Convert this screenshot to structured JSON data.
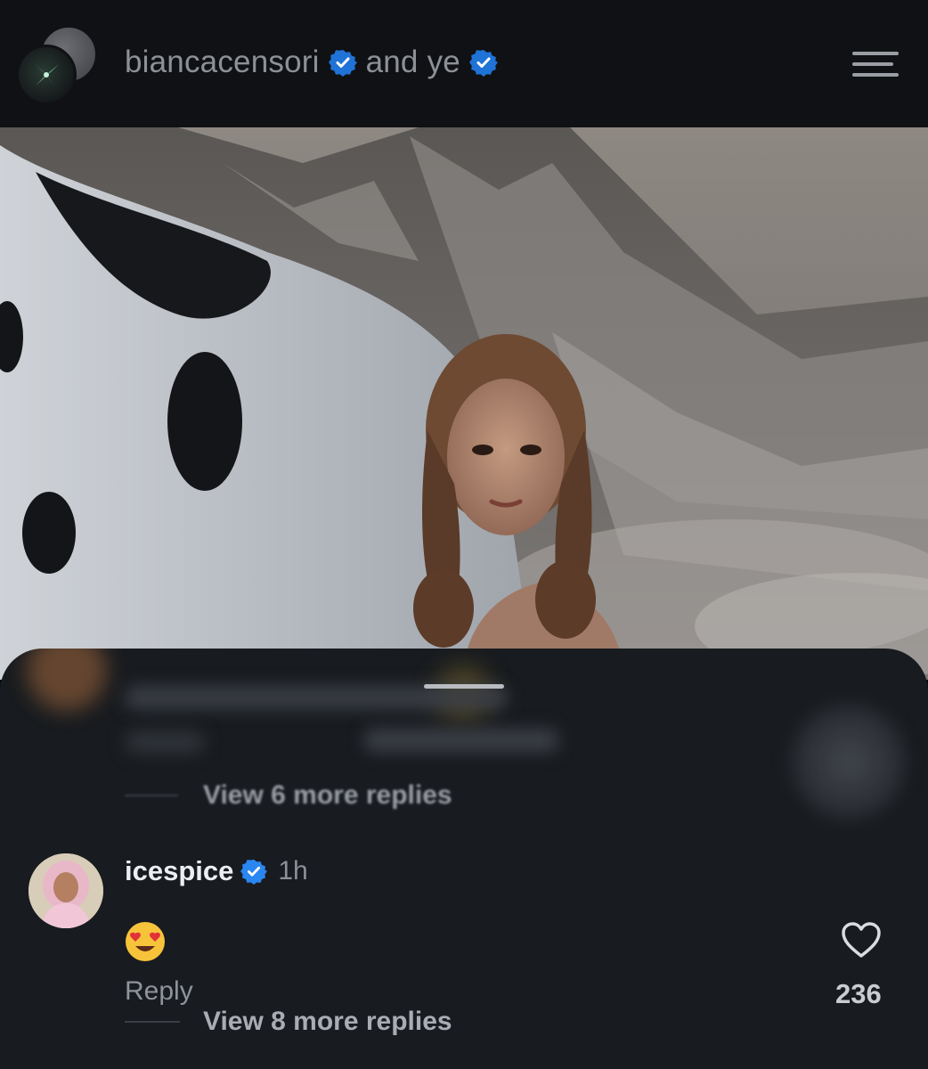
{
  "header": {
    "username": "biancacensori",
    "joiner": "and",
    "collaborator": "ye",
    "accent_color": "#1f73d6"
  },
  "icons": {
    "verified": "verified-badge-icon",
    "menu": "hamburger-menu-icon",
    "like": "heart-outline-icon"
  },
  "post": {
    "image_desc": "Woman with braided pigtails in front of snowy mountains beside a black-and-white cow-print form"
  },
  "comments": {
    "blurred_view_more": "View 6 more replies",
    "comment": {
      "username": "icespice",
      "time": "1h",
      "emoji": "😍",
      "reply_label": "Reply",
      "likes": "236",
      "view_more": "View 8 more replies"
    }
  }
}
